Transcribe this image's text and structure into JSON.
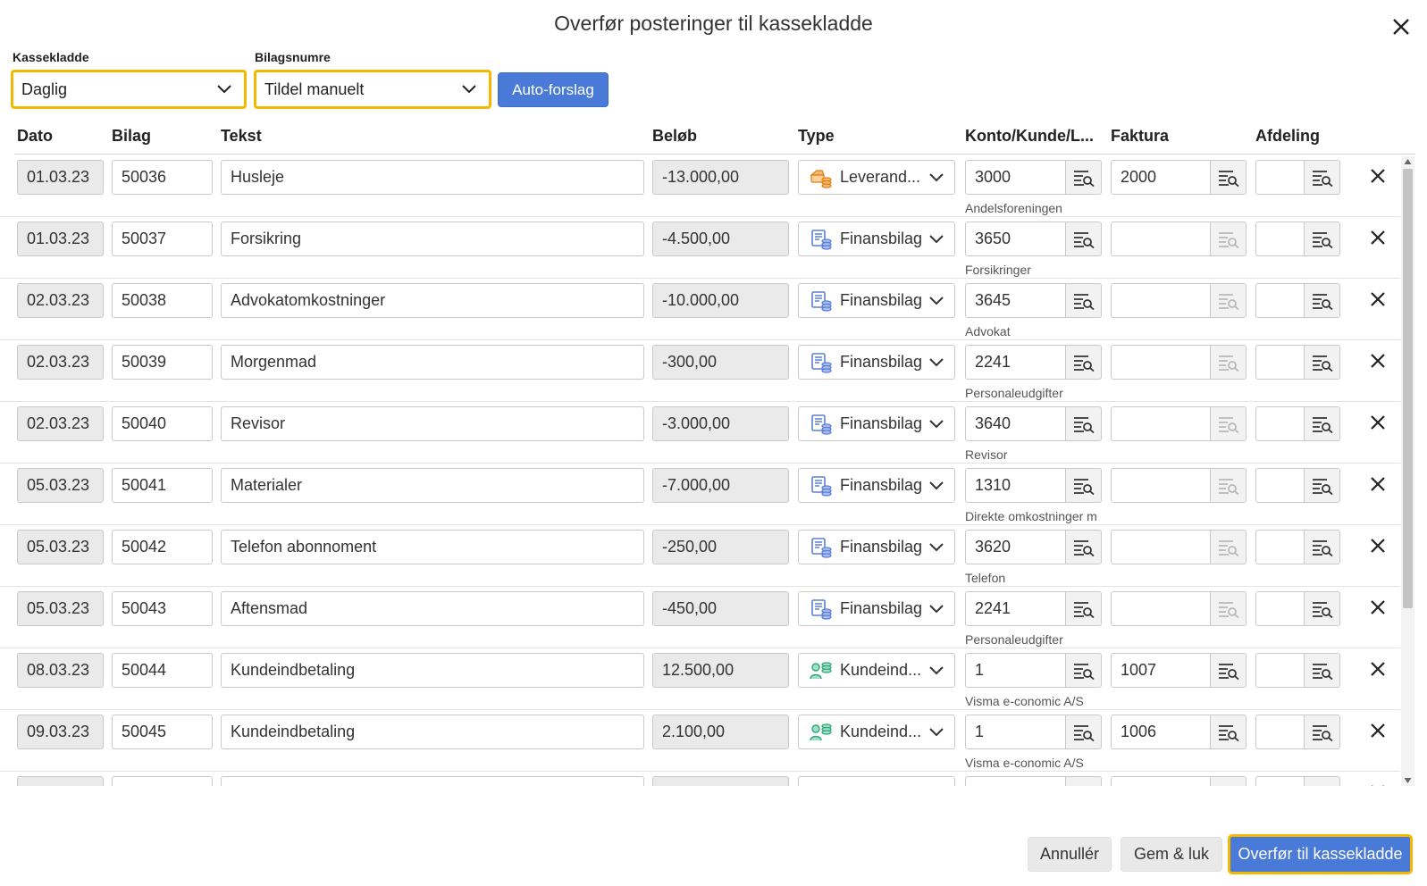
{
  "dialog": {
    "title": "Overfør posteringer til kassekladde"
  },
  "filters": {
    "kassekladde_label": "Kassekladde",
    "kassekladde_value": "Daglig",
    "bilagsnumre_label": "Bilagsnumre",
    "bilagsnumre_value": "Tildel manuelt",
    "auto_forslag_label": "Auto-forslag"
  },
  "columns": {
    "dato": "Dato",
    "bilag": "Bilag",
    "tekst": "Tekst",
    "belob": "Beløb",
    "type": "Type",
    "konto": "Konto/Kunde/L...",
    "faktura": "Faktura",
    "afdeling": "Afdeling"
  },
  "rows": [
    {
      "dato": "01.03.23",
      "bilag": "50036",
      "tekst": "Husleje",
      "belob": "-13.000,00",
      "type": "Leverand...",
      "type_icon": "supplier-icon",
      "konto": "3000",
      "konto_name": "Andelsforeningen",
      "faktura": "2000",
      "afdeling": ""
    },
    {
      "dato": "01.03.23",
      "bilag": "50037",
      "tekst": "Forsikring",
      "belob": "-4.500,00",
      "type": "Finansbilag",
      "type_icon": "finance-icon",
      "konto": "3650",
      "konto_name": "Forsikringer",
      "faktura": "",
      "afdeling": ""
    },
    {
      "dato": "02.03.23",
      "bilag": "50038",
      "tekst": "Advokatomkostninger",
      "belob": "-10.000,00",
      "type": "Finansbilag",
      "type_icon": "finance-icon",
      "konto": "3645",
      "konto_name": "Advokat",
      "faktura": "",
      "afdeling": ""
    },
    {
      "dato": "02.03.23",
      "bilag": "50039",
      "tekst": "Morgenmad",
      "belob": "-300,00",
      "type": "Finansbilag",
      "type_icon": "finance-icon",
      "konto": "2241",
      "konto_name": "Personaleudgifter",
      "faktura": "",
      "afdeling": ""
    },
    {
      "dato": "02.03.23",
      "bilag": "50040",
      "tekst": "Revisor",
      "belob": "-3.000,00",
      "type": "Finansbilag",
      "type_icon": "finance-icon",
      "konto": "3640",
      "konto_name": "Revisor",
      "faktura": "",
      "afdeling": ""
    },
    {
      "dato": "05.03.23",
      "bilag": "50041",
      "tekst": "Materialer",
      "belob": "-7.000,00",
      "type": "Finansbilag",
      "type_icon": "finance-icon",
      "konto": "1310",
      "konto_name": "Direkte omkostninger m",
      "faktura": "",
      "afdeling": ""
    },
    {
      "dato": "05.03.23",
      "bilag": "50042",
      "tekst": "Telefon abonnoment",
      "belob": "-250,00",
      "type": "Finansbilag",
      "type_icon": "finance-icon",
      "konto": "3620",
      "konto_name": "Telefon",
      "faktura": "",
      "afdeling": ""
    },
    {
      "dato": "05.03.23",
      "bilag": "50043",
      "tekst": "Aftensmad",
      "belob": "-450,00",
      "type": "Finansbilag",
      "type_icon": "finance-icon",
      "konto": "2241",
      "konto_name": "Personaleudgifter",
      "faktura": "",
      "afdeling": ""
    },
    {
      "dato": "08.03.23",
      "bilag": "50044",
      "tekst": "Kundeindbetaling",
      "belob": "12.500,00",
      "type": "Kundeind...",
      "type_icon": "customer-payment-icon",
      "konto": "1",
      "konto_name": "Visma e-conomic A/S",
      "faktura": "1007",
      "afdeling": ""
    },
    {
      "dato": "09.03.23",
      "bilag": "50045",
      "tekst": "Kundeindbetaling",
      "belob": "2.100,00",
      "type": "Kundeind...",
      "type_icon": "customer-payment-icon",
      "konto": "1",
      "konto_name": "Visma e-conomic A/S",
      "faktura": "1006",
      "afdeling": ""
    },
    {
      "dato": "",
      "bilag": "",
      "tekst": "",
      "belob": "",
      "type": "",
      "type_icon": "",
      "konto": "",
      "konto_name": "",
      "faktura": "",
      "afdeling": ""
    }
  ],
  "footer": {
    "cancel_label": "Annullér",
    "save_close_label": "Gem & luk",
    "transfer_label": "Overfør til kassekladde"
  },
  "colors": {
    "accent": "#4a7ad8",
    "highlight": "#f5b800",
    "readonly_bg": "#eaeaea"
  }
}
